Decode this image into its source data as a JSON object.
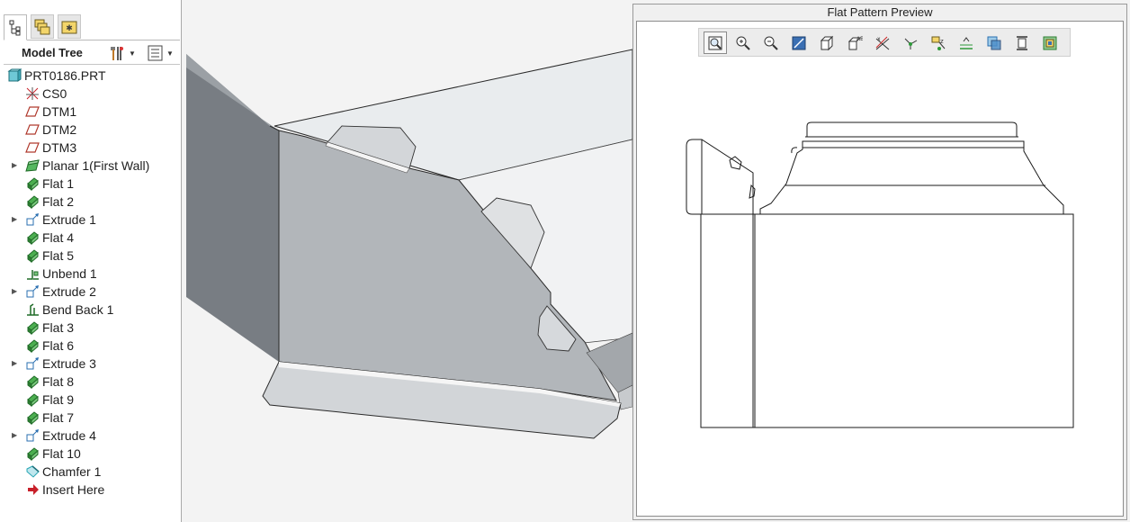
{
  "model_tree": {
    "title": "Model Tree",
    "tabs": [
      "model-tree-tab",
      "layer-tree-tab",
      "favorites-tab"
    ],
    "items": [
      {
        "label": "PRT0186.PRT",
        "icon": "part-icon",
        "expandable": false,
        "root": true
      },
      {
        "label": "CS0",
        "icon": "coordinate-system-icon",
        "expandable": false
      },
      {
        "label": "DTM1",
        "icon": "datum-plane-icon",
        "expandable": false
      },
      {
        "label": "DTM2",
        "icon": "datum-plane-icon",
        "expandable": false
      },
      {
        "label": "DTM3",
        "icon": "datum-plane-icon",
        "expandable": false
      },
      {
        "label": "Planar 1(First Wall)",
        "icon": "planar-wall-icon",
        "expandable": true
      },
      {
        "label": "Flat 1",
        "icon": "flat-wall-icon",
        "expandable": false
      },
      {
        "label": "Flat 2",
        "icon": "flat-wall-icon",
        "expandable": false
      },
      {
        "label": "Extrude 1",
        "icon": "extrude-icon",
        "expandable": true
      },
      {
        "label": "Flat 4",
        "icon": "flat-wall-icon",
        "expandable": false
      },
      {
        "label": "Flat 5",
        "icon": "flat-wall-icon",
        "expandable": false
      },
      {
        "label": "Unbend 1",
        "icon": "unbend-icon",
        "expandable": false
      },
      {
        "label": "Extrude 2",
        "icon": "extrude-icon",
        "expandable": true
      },
      {
        "label": "Bend Back 1",
        "icon": "bend-back-icon",
        "expandable": false
      },
      {
        "label": "Flat 3",
        "icon": "flat-wall-icon",
        "expandable": false
      },
      {
        "label": "Flat 6",
        "icon": "flat-wall-icon",
        "expandable": false
      },
      {
        "label": "Extrude 3",
        "icon": "extrude-icon",
        "expandable": true
      },
      {
        "label": "Flat 8",
        "icon": "flat-wall-icon",
        "expandable": false
      },
      {
        "label": "Flat 9",
        "icon": "flat-wall-icon",
        "expandable": false
      },
      {
        "label": "Flat 7",
        "icon": "flat-wall-icon",
        "expandable": false
      },
      {
        "label": "Extrude 4",
        "icon": "extrude-icon",
        "expandable": true
      },
      {
        "label": "Flat 10",
        "icon": "flat-wall-icon",
        "expandable": false
      },
      {
        "label": "Chamfer 1",
        "icon": "chamfer-icon",
        "expandable": false
      },
      {
        "label": "Insert Here",
        "icon": "insert-arrow-icon",
        "expandable": false
      }
    ]
  },
  "preview": {
    "title": "Flat Pattern Preview",
    "toolbar": [
      {
        "name": "refit-icon",
        "boxed": true
      },
      {
        "name": "zoom-in-icon",
        "boxed": false
      },
      {
        "name": "zoom-out-icon",
        "boxed": false
      },
      {
        "name": "repaint-icon",
        "boxed": false
      },
      {
        "name": "display-style-icon",
        "boxed": false
      },
      {
        "name": "saved-orientations-icon",
        "boxed": false
      },
      {
        "name": "datum-display-icon",
        "boxed": false
      },
      {
        "name": "point-display-icon",
        "boxed": false
      },
      {
        "name": "csys-display-icon",
        "boxed": false
      },
      {
        "name": "annotation-display-icon",
        "boxed": false
      },
      {
        "name": "spin-center-icon",
        "boxed": false
      },
      {
        "name": "sketch-view-icon",
        "boxed": false
      },
      {
        "name": "flat-pattern-settings-icon",
        "boxed": false
      }
    ]
  },
  "colors": {
    "icon_green": "#2e9a3a",
    "icon_red": "#c8202a",
    "icon_teal": "#2aa7b5",
    "sheet_dark": "#7b8086",
    "sheet_mid": "#b4b8bc",
    "sheet_light": "#dfe1e3"
  }
}
